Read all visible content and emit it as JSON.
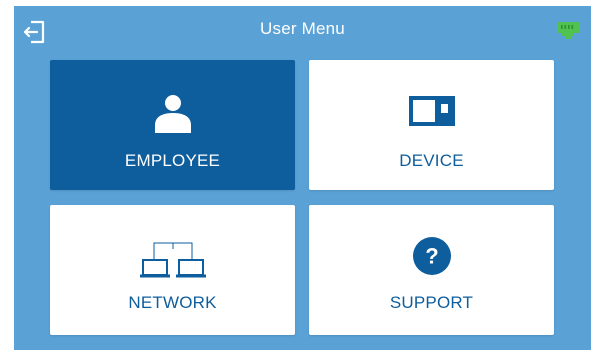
{
  "header": {
    "title": "User Menu",
    "exit_icon": "exit-icon",
    "status_icon": "network-connected-icon"
  },
  "tiles": [
    {
      "label": "EMPLOYEE",
      "icon": "person-icon",
      "selected": true
    },
    {
      "label": "DEVICE",
      "icon": "device-icon",
      "selected": false
    },
    {
      "label": "NETWORK",
      "icon": "network-icon",
      "selected": false
    },
    {
      "label": "SUPPORT",
      "icon": "help-icon",
      "selected": false
    }
  ],
  "colors": {
    "background": "#5aa2d6",
    "accent": "#0e5d9c",
    "tile": "#ffffff",
    "status_green": "#4fc24f"
  }
}
